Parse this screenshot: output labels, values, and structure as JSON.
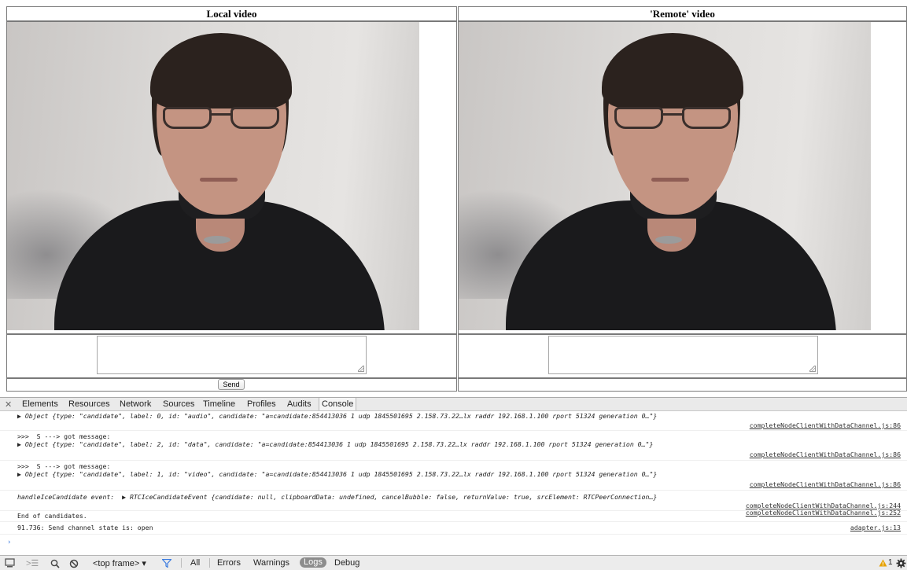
{
  "page": {
    "local_video_header": "Local video",
    "remote_video_header": "'Remote' video",
    "send_button_label": "Send"
  },
  "devtools": {
    "tabs": [
      "Elements",
      "Resources",
      "Network",
      "Sources",
      "Timeline",
      "Profiles",
      "Audits",
      "Console"
    ],
    "active_tab": "Console",
    "console": {
      "entries": [
        {
          "line1": "",
          "line2": "▶ Object {type: \"candidate\", label: 0, id: \"audio\", candidate: \"a=candidate:854413036 1 udp 1845501695 2.158.73.22…lx raddr 192.168.1.100 rport 51324 generation 0…\"}",
          "source": "completeNodeClientWithDataChannel.js:86"
        },
        {
          "line1": ">>>  S ---> got message:",
          "line2": "▶ Object {type: \"candidate\", label: 2, id: \"data\", candidate: \"a=candidate:854413036 1 udp 1845501695 2.158.73.22…lx raddr 192.168.1.100 rport 51324 generation 0…\"}",
          "source": "completeNodeClientWithDataChannel.js:86"
        },
        {
          "line1": ">>>  S ---> got message:",
          "line2": "▶ Object {type: \"candidate\", label: 1, id: \"video\", candidate: \"a=candidate:854413036 1 udp 1845501695 2.158.73.22…lx raddr 192.168.1.100 rport 51324 generation 0…\"}",
          "source": "completeNodeClientWithDataChannel.js:86"
        },
        {
          "line1": "handleIceCandidate event:  ▶ RTCIceCandidateEvent {candidate: null, clipboardData: undefined, cancelBubble: false, returnValue: true, srcElement: RTCPeerConnection…}",
          "source": "completeNodeClientWithDataChannel.js:244"
        },
        {
          "line1": "End of candidates.",
          "source": "completeNodeClientWithDataChannel.js:252"
        },
        {
          "line1": "91.736: Send channel state is: open",
          "source": "adapter.js:13"
        }
      ],
      "prompt": "›"
    },
    "bottom_bar": {
      "frame_selector": "<top frame> ▾",
      "filters": [
        "All",
        "Errors",
        "Warnings",
        "Logs",
        "Debug"
      ],
      "active_filter": "Logs",
      "warning_count": "1"
    }
  },
  "colors": {
    "link": "#333333",
    "prompt": "#3a7be0",
    "filter_icon": "#3a7be0",
    "warning": "#e6a100"
  }
}
